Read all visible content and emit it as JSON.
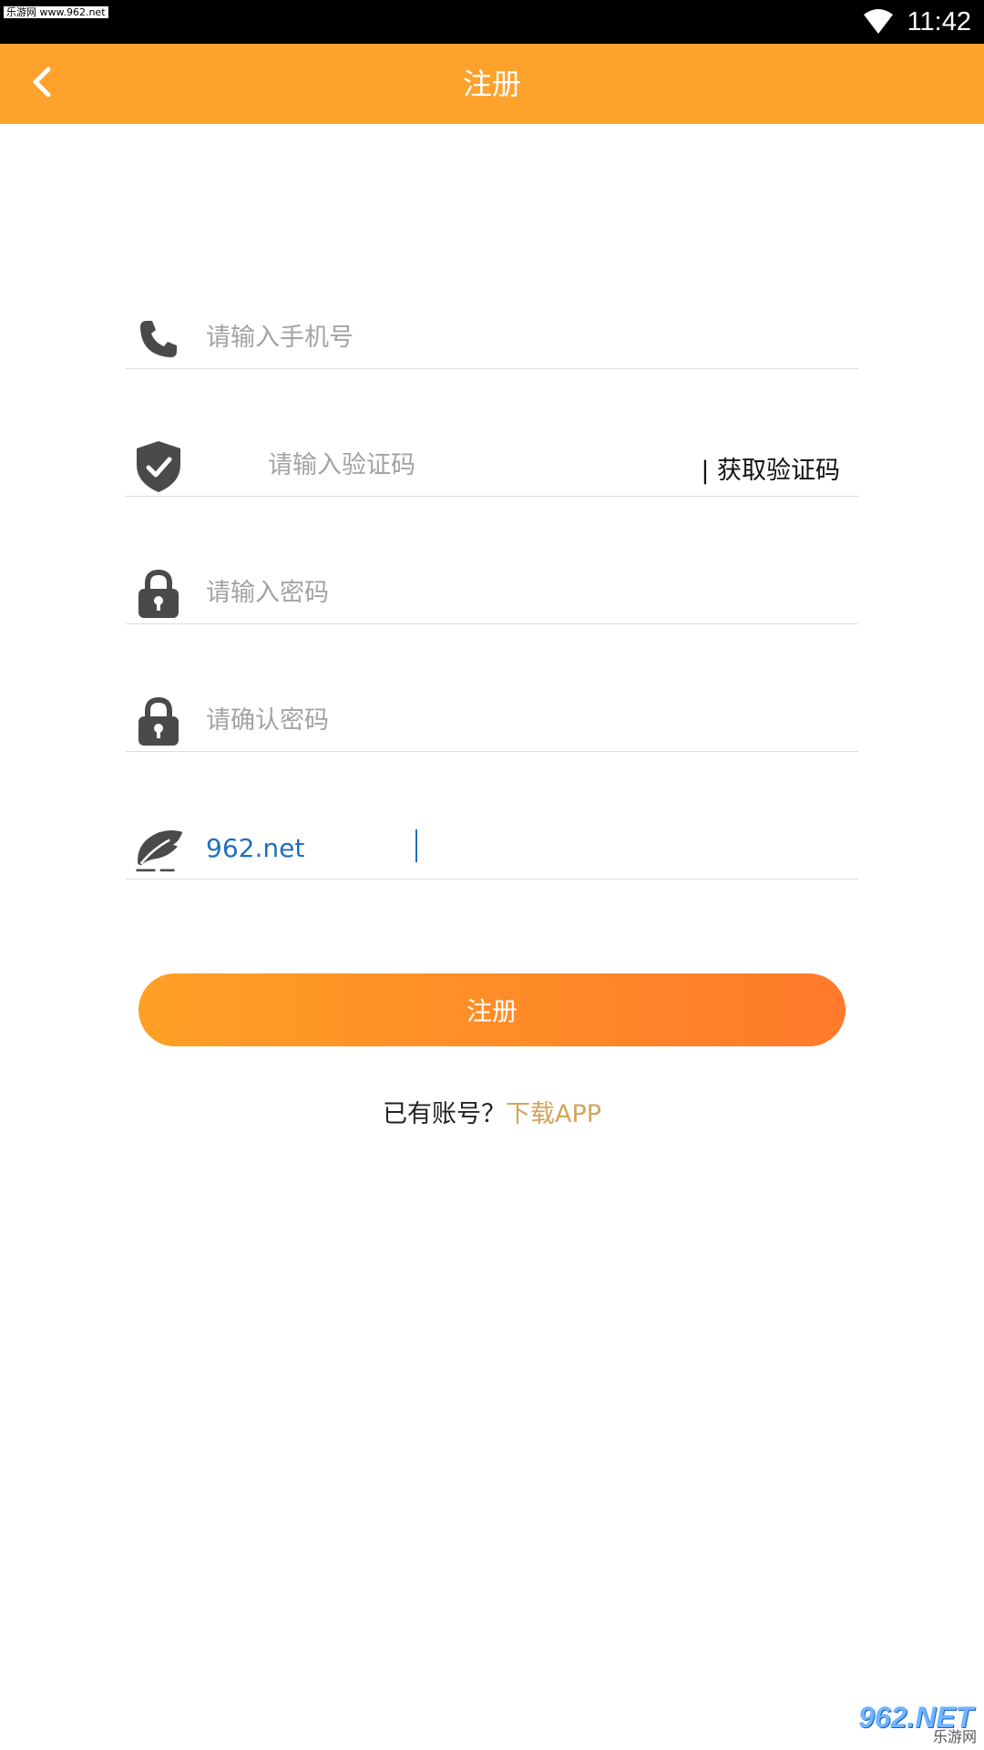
{
  "status_bar": {
    "watermark": "乐游网 www.962.net",
    "time": "11:42",
    "wifi_icon": "wifi-icon"
  },
  "app_bar": {
    "back_icon": "chevron-left-icon",
    "title": "注册",
    "background": "#ffa22c"
  },
  "form": {
    "phone": {
      "icon": "phone-icon",
      "placeholder": "请输入手机号",
      "value": ""
    },
    "code": {
      "icon": "shield-check-icon",
      "placeholder": "请输入验证码",
      "value": "",
      "get_code_label": "| 获取验证码"
    },
    "password": {
      "icon": "lock-icon",
      "placeholder": "请输入密码",
      "value": ""
    },
    "confirm_password": {
      "icon": "lock-icon",
      "placeholder": "请确认密码",
      "value": ""
    },
    "referral": {
      "icon": "feather-quill-icon",
      "placeholder": "",
      "value": "962.net"
    }
  },
  "register_button": {
    "label": "注册",
    "gradient_start": "#ffa025",
    "gradient_end": "#ff7a2a"
  },
  "login_prompt": {
    "text": "已有账号？",
    "link": "下载APP",
    "link_color": "#d2a45b"
  },
  "corner_watermark": {
    "brand": "962.NET",
    "sub": "乐游网"
  }
}
